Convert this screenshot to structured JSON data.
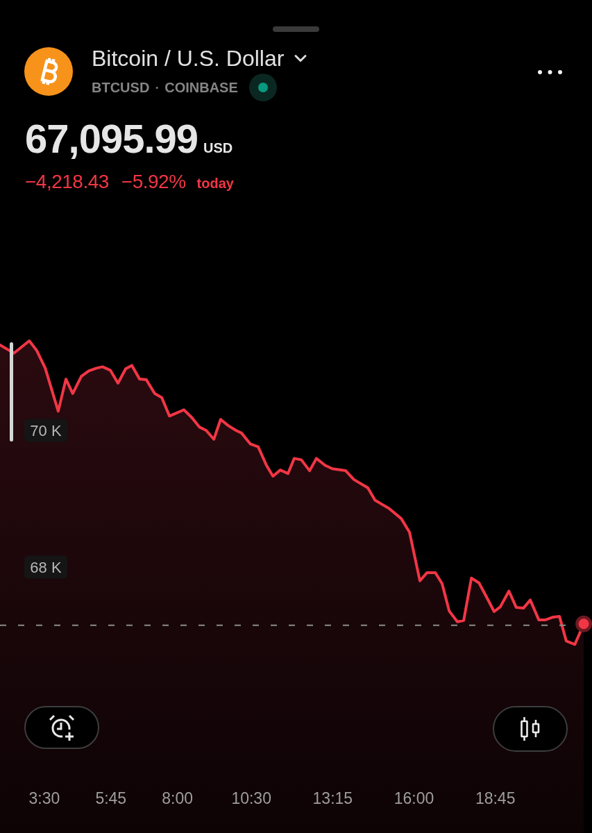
{
  "symbol": {
    "name": "Bitcoin / U.S. Dollar",
    "ticker": "BTCUSD",
    "separator": "•",
    "exchange": "COINBASE",
    "market_open": true
  },
  "quote": {
    "price": "67,095.99",
    "currency": "USD",
    "change": "−4,218.43",
    "change_percent": "−5.92%",
    "period": "today",
    "negative": true
  },
  "chart": {
    "chart_data": {
      "type": "area",
      "x": [
        2.0,
        2.47,
        2.99,
        3.24,
        3.53,
        3.97,
        4.23,
        4.46,
        4.75,
        5.0,
        5.26,
        5.47,
        5.73,
        5.99,
        6.25,
        6.46,
        6.72,
        6.95,
        7.23,
        7.47,
        7.73,
        8.22,
        8.48,
        8.74,
        8.97,
        9.23,
        9.46,
        9.72,
        9.98,
        10.17,
        10.47,
        10.73,
        11.01,
        11.23,
        11.48,
        11.74,
        11.95,
        12.19,
        12.47,
        12.7,
        12.99,
        13.24,
        13.69,
        13.97,
        14.44,
        14.68,
        14.91,
        15.15,
        15.57,
        15.85,
        16.2,
        16.44,
        16.72,
        16.95,
        17.19,
        17.47,
        17.68,
        17.94,
        18.2,
        18.48,
        18.71,
        18.92,
        19.21,
        19.46,
        19.7,
        19.93,
        20.22,
        20.45,
        20.71,
        20.92,
        21.15,
        21.44,
        21.74
      ],
      "values": [
        71250,
        71130,
        71310,
        71170,
        70910,
        70280,
        70750,
        70540,
        70790,
        70870,
        70910,
        70930,
        70880,
        70690,
        70900,
        70950,
        70750,
        70740,
        70540,
        70480,
        70210,
        70300,
        70190,
        70050,
        70000,
        69870,
        70160,
        70070,
        70000,
        69960,
        69800,
        69760,
        69490,
        69330,
        69420,
        69370,
        69590,
        69570,
        69410,
        69590,
        69490,
        69440,
        69410,
        69280,
        69160,
        68980,
        68920,
        68860,
        68710,
        68510,
        67800,
        67920,
        67920,
        67760,
        67360,
        67200,
        67220,
        67840,
        67770,
        67540,
        67350,
        67420,
        67650,
        67410,
        67400,
        67520,
        67230,
        67230,
        67270,
        67280,
        66920,
        66870,
        67170
      ],
      "xlim": [
        2,
        22.02
      ],
      "ylim": [
        64112,
        76294
      ],
      "xticks": [
        {
          "value": 3.5,
          "label": "3:30"
        },
        {
          "value": 5.75,
          "label": "5:45"
        },
        {
          "value": 8,
          "label": "8:00"
        },
        {
          "value": 10.5,
          "label": "10:30"
        },
        {
          "value": 13.25,
          "label": "13:15"
        },
        {
          "value": 16,
          "label": "16:00"
        },
        {
          "value": 18.75,
          "label": "18:45"
        }
      ],
      "yticks": [
        {
          "value": 70000,
          "label": "70 K"
        },
        {
          "value": 68000,
          "label": "68 K"
        }
      ]
    }
  }
}
